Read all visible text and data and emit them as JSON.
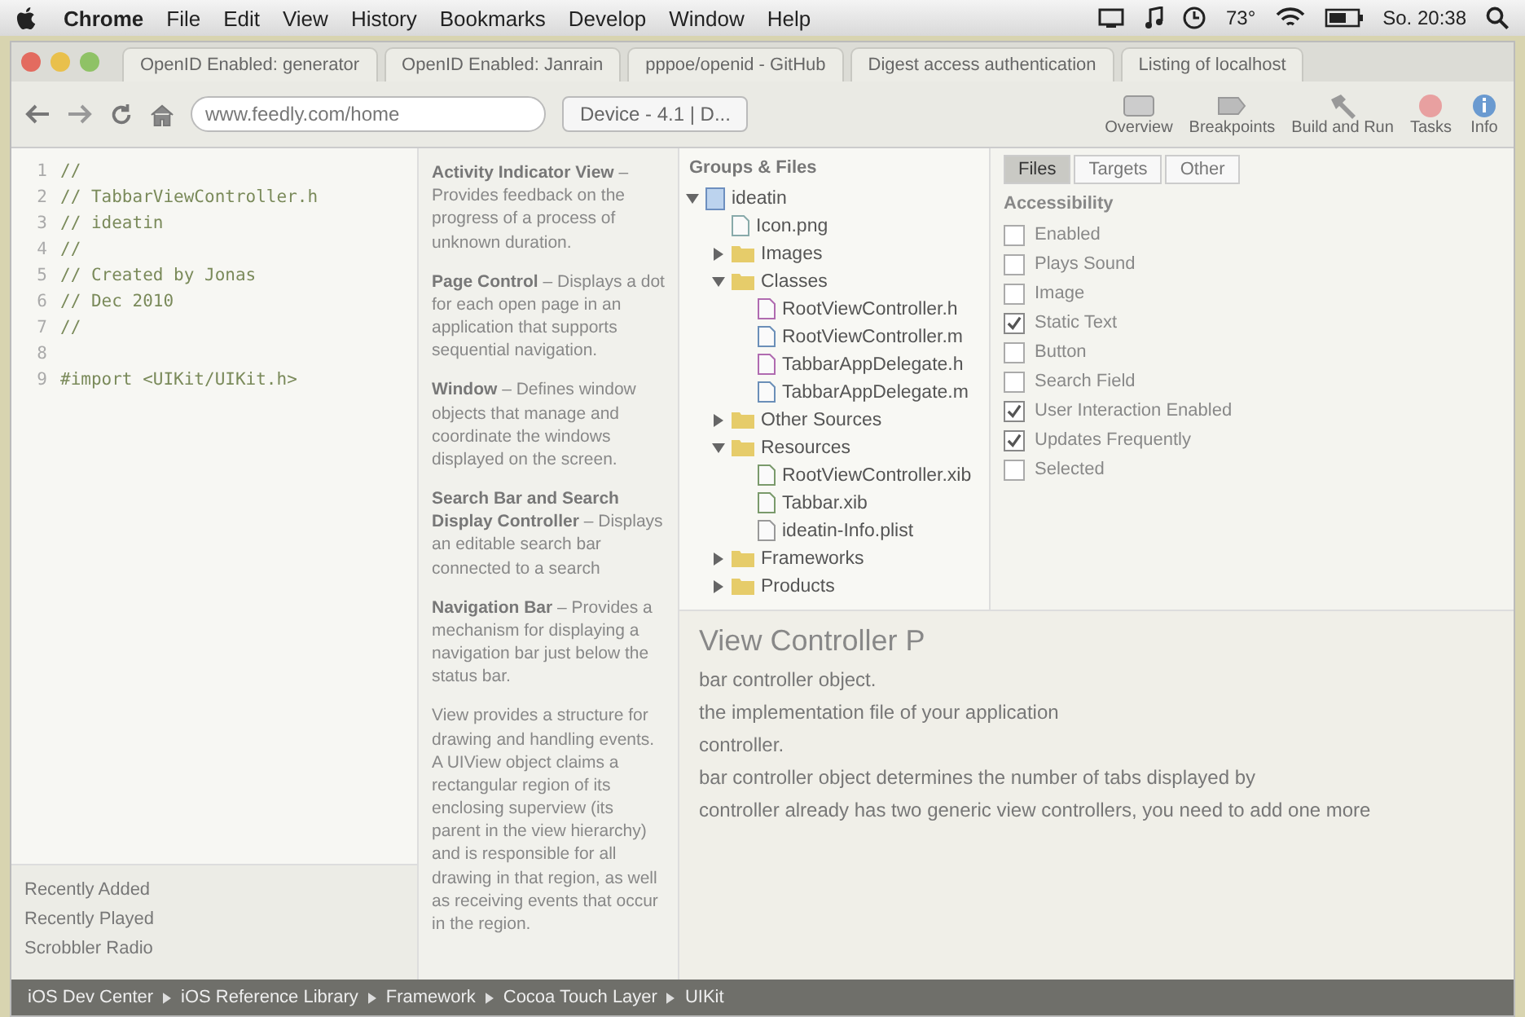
{
  "menubar": {
    "items": [
      "Chrome",
      "File",
      "Edit",
      "View",
      "History",
      "Bookmarks",
      "Develop",
      "Window",
      "Help"
    ],
    "temperature": "73°",
    "clock": "So. 20:38"
  },
  "browser": {
    "tabs": [
      "OpenID Enabled: generator",
      "OpenID Enabled: Janrain",
      "pppoe/openid - GitHub",
      "Digest access authentication",
      "Listing of localhost"
    ],
    "url": "www.feedly.com/home"
  },
  "xcode_toolbar": {
    "scheme": "Device - 4.1 | D...",
    "buttons": [
      "Overview",
      "Breakpoints",
      "Build and Run",
      "Tasks",
      "Info"
    ]
  },
  "sidebar": {
    "items": [
      "Recently Added",
      "Recently Played",
      "Scrobbler Radio"
    ]
  },
  "code": {
    "lines": [
      {
        "number": "1",
        "text": "//"
      },
      {
        "number": "2",
        "text": "//  TabbarViewController.h"
      },
      {
        "number": "3",
        "text": "//  ideatin"
      },
      {
        "number": "4",
        "text": "//"
      },
      {
        "number": "5",
        "text": "//  Created by Jonas"
      },
      {
        "number": "6",
        "text": "//  Dec 2010"
      },
      {
        "number": "7",
        "text": "//"
      },
      {
        "number": "8"
      },
      {
        "number": "9",
        "text": "#import <UIKit/UIKit.h>"
      }
    ]
  },
  "docs": {
    "entries": [
      {
        "term": "Activity Indicator View",
        "text": "– Provides feedback on the progress of a process of unknown duration."
      },
      {
        "term": "Page Control",
        "text": "– Displays a dot for each open page in an application that supports sequential navigation."
      },
      {
        "term": "Window",
        "text": "– Defines window objects that manage and coordinate the windows displayed on the screen."
      },
      {
        "term": "Search Bar and Search Display Controller",
        "text": "– Displays an editable search bar connected to a search"
      },
      {
        "term": "Navigation Bar",
        "text": "– Provides a mechanism for displaying a navigation bar just below the status bar."
      }
    ]
  },
  "groups_and_files": {
    "title": "Groups & Files",
    "tabs": [
      {
        "label": "Files",
        "selected": true
      },
      {
        "label": "Targets",
        "selected": false
      },
      {
        "label": "Other",
        "selected": false
      }
    ],
    "tree": [
      {
        "name": "ideatin",
        "kind": "project",
        "expanded": true,
        "children": [
          {
            "name": "Icon.png",
            "kind": "image"
          },
          {
            "name": "Images",
            "kind": "folder",
            "expanded": false
          },
          {
            "name": "Classes",
            "kind": "folder",
            "expanded": true,
            "children": [
              {
                "name": "RootViewController.h",
                "kind": "header"
              },
              {
                "name": "RootViewController.m",
                "kind": "source"
              },
              {
                "name": "TabbarAppDelegate.h",
                "kind": "header"
              },
              {
                "name": "TabbarAppDelegate.m",
                "kind": "source"
              }
            ]
          },
          {
            "name": "Other Sources",
            "kind": "folder",
            "expanded": false
          },
          {
            "name": "Resources",
            "kind": "folder",
            "expanded": true,
            "children": [
              {
                "name": "RootViewController.xib",
                "kind": "xib"
              },
              {
                "name": "Tabbar.xib",
                "kind": "xib"
              },
              {
                "name": "ideatin-Info.plist",
                "kind": "plist"
              }
            ]
          },
          {
            "name": "Frameworks",
            "kind": "folder",
            "expanded": false
          },
          {
            "name": "Products",
            "kind": "folder",
            "expanded": false
          }
        ]
      }
    ]
  },
  "inspector": {
    "title": "Accessibility",
    "options": [
      {
        "label": "Enabled",
        "checked": false
      },
      {
        "label": "Plays Sound",
        "checked": false
      },
      {
        "label": "Image",
        "checked": false
      },
      {
        "label": "Static Text",
        "checked": true
      },
      {
        "label": "Button",
        "checked": false
      },
      {
        "label": "Search Field",
        "checked": false
      },
      {
        "label": "User Interaction Enabled",
        "checked": true
      },
      {
        "label": "Updates Frequently",
        "checked": true
      },
      {
        "label": "Selected",
        "checked": false
      }
    ]
  },
  "article": {
    "title": "View Controller P",
    "paragraphs": [
      "bar controller object.",
      "the implementation file of your application",
      "controller.",
      "bar controller object determines the number of tabs displayed by",
      "controller already has two generic view controllers, you need to add one more"
    ],
    "view_description": "View provides a structure for drawing and handling events. A UIView object claims a rectangular region of its enclosing superview (its parent in the view hierarchy) and is responsible for all drawing in that region, as well as receiving events that occur in the region."
  },
  "breadcrumb": [
    "iOS Dev Center",
    "iOS Reference Library",
    "Framework",
    "Cocoa Touch Layer",
    "UIKit"
  ]
}
